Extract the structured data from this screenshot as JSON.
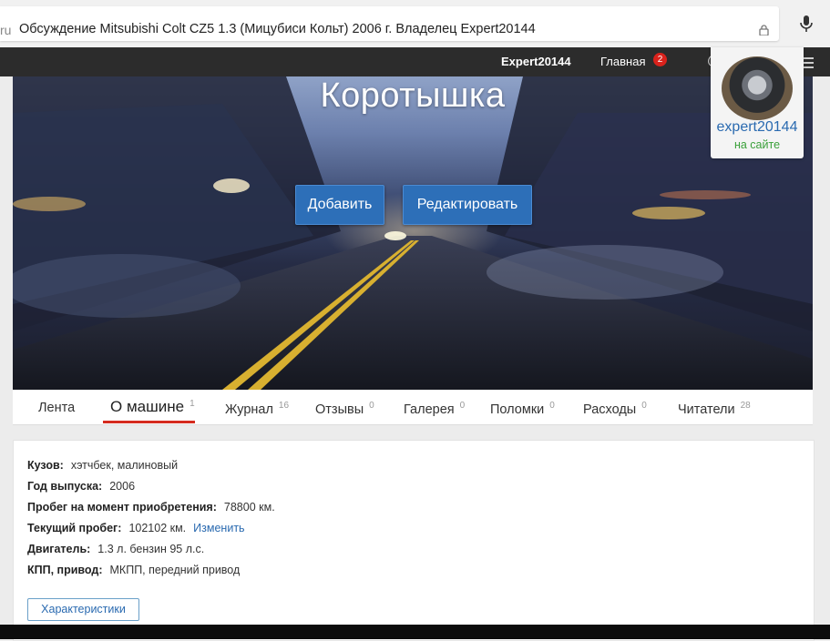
{
  "browser": {
    "domain_tail": "ru",
    "page_title": "Обсуждение Mitsubishi Colt CZ5 1.3 (Мицубиси Кольт) 2006 г. Владелец Expert20144"
  },
  "topnav": {
    "username": "Expert20144",
    "home_label": "Главная",
    "home_badge": "2",
    "at_symbol": "@",
    "icons": [
      "mail-icon",
      "menu-icon"
    ]
  },
  "profile": {
    "username": "expert20144",
    "status": "на сайте"
  },
  "hero": {
    "title": "Коротышка",
    "add_label": "Добавить",
    "edit_label": "Редактировать"
  },
  "tabs": [
    {
      "label": "Лента",
      "count": ""
    },
    {
      "label": "О машине",
      "count": "1",
      "active": true
    },
    {
      "label": "Журнал",
      "count": "16"
    },
    {
      "label": "Отзывы",
      "count": "0"
    },
    {
      "label": "Галерея",
      "count": "0"
    },
    {
      "label": "Поломки",
      "count": "0"
    },
    {
      "label": "Расходы",
      "count": "0"
    },
    {
      "label": "Читатели",
      "count": "28"
    }
  ],
  "specs": [
    {
      "label": "Кузов:",
      "value": "хэтчбек, малиновый"
    },
    {
      "label": "Год выпуска:",
      "value": "2006"
    },
    {
      "label": "Пробег на момент приобретения:",
      "value": "78800 км."
    },
    {
      "label": "Текущий пробег:",
      "value": "102102 км.",
      "link": "Изменить"
    },
    {
      "label": "Двигатель:",
      "value": "1.3 л. бензин 95 л.с."
    },
    {
      "label": "КПП, привод:",
      "value": "МКПП, передний привод"
    }
  ],
  "specs_button": "Характеристики",
  "colors": {
    "accent_blue": "#2d6fb8",
    "active_tab": "#d52b1e",
    "online_green": "#3aa03a",
    "link": "#2a6ab0"
  }
}
